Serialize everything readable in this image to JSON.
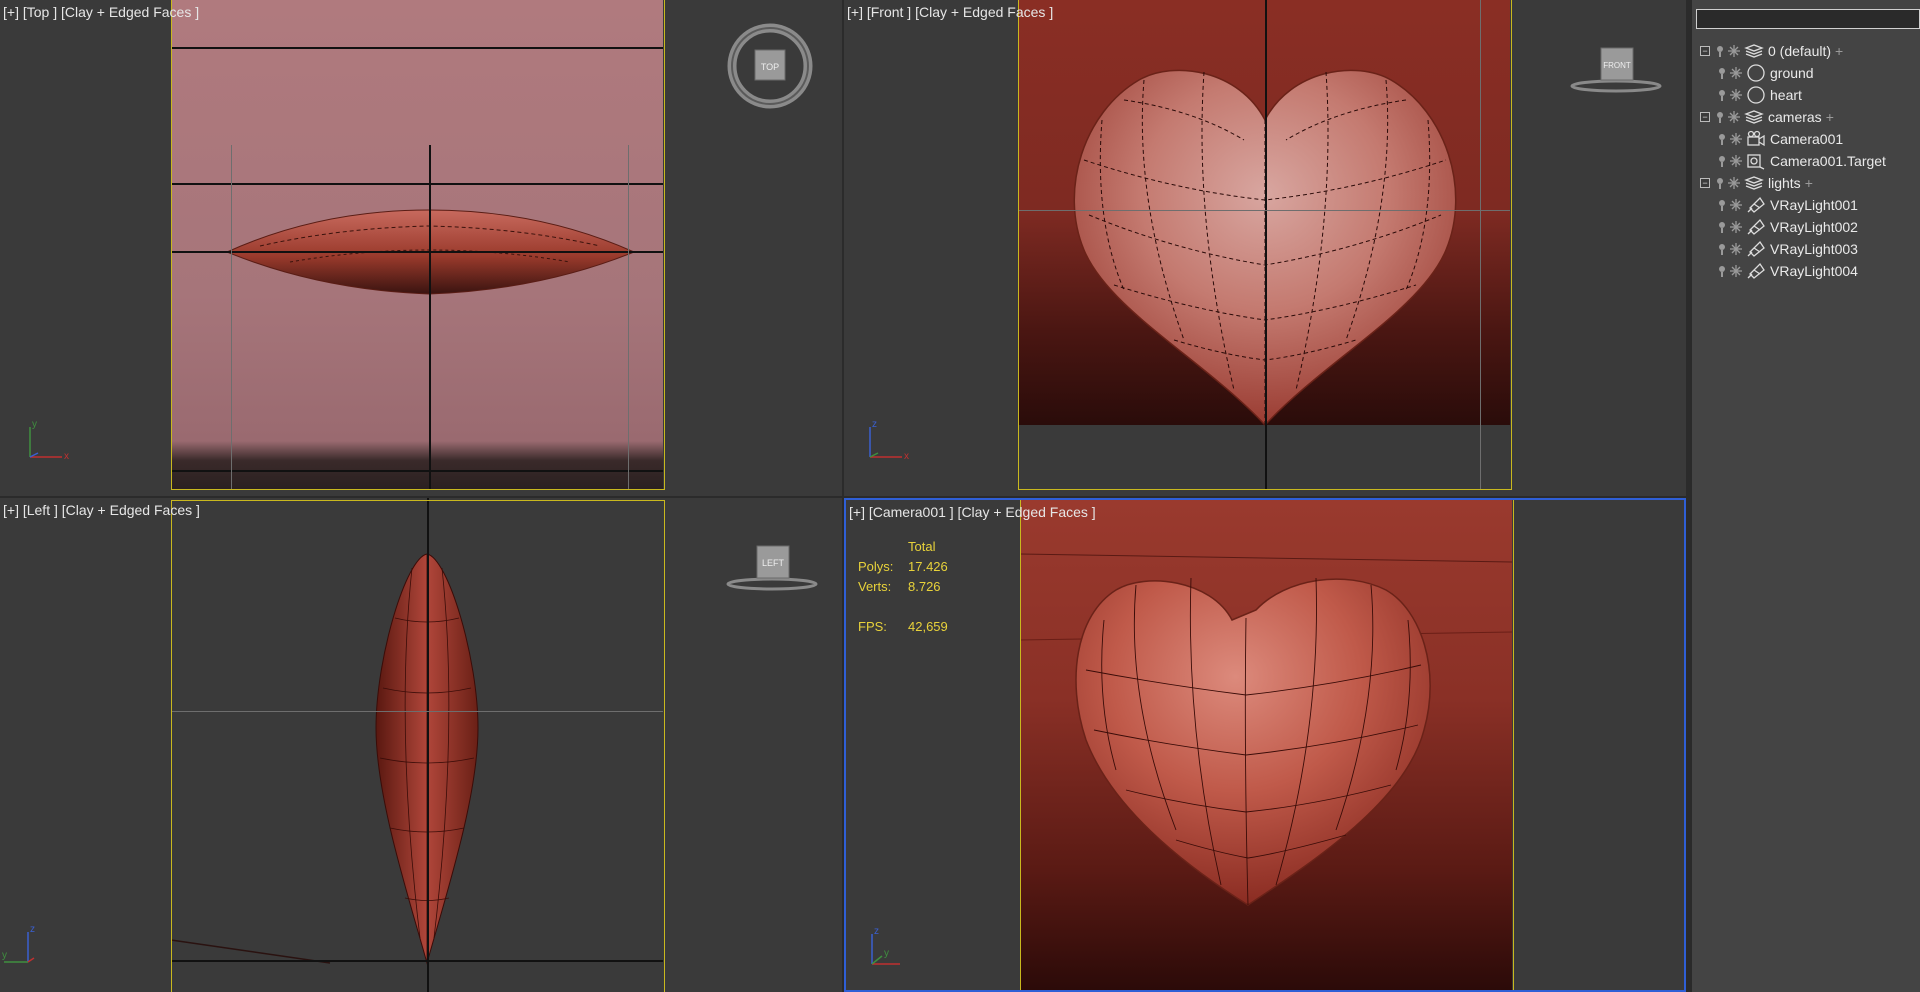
{
  "viewports": {
    "top": {
      "label": "[+] [Top ] [Clay + Edged Faces ]",
      "viewcube": "TOP"
    },
    "front": {
      "label": "[+] [Front ] [Clay + Edged Faces ]",
      "viewcube": "FRONT"
    },
    "left": {
      "label": "[+] [Left ] [Clay + Edged Faces ]",
      "viewcube": "LEFT"
    },
    "camera": {
      "label": "[+] [Camera001 ] [Clay + Edged Faces ]"
    }
  },
  "stats": {
    "header": "Total",
    "polys_label": "Polys:",
    "polys_value": "17.426",
    "verts_label": "Verts:",
    "verts_value": "8.726",
    "fps_label": "FPS:",
    "fps_value": "42,659"
  },
  "axis": {
    "x": "x",
    "y": "y",
    "z": "z"
  },
  "scene_explorer": {
    "search_value": "",
    "layers": [
      {
        "name": "0 (default)",
        "items": [
          "ground",
          "heart"
        ]
      },
      {
        "name": "cameras",
        "items": [
          "Camera001",
          "Camera001.Target"
        ]
      },
      {
        "name": "lights",
        "items": [
          "VRayLight001",
          "VRayLight002",
          "VRayLight003",
          "VRayLight004"
        ]
      }
    ],
    "expand_symbol": "−",
    "add_symbol": "+"
  },
  "colors": {
    "viewport_bg": "#3a3a3a",
    "safe_frame": "#c9b81e",
    "active_border": "#2f5fd6",
    "stats": "#e8d23a",
    "heart": "#b0463a"
  }
}
